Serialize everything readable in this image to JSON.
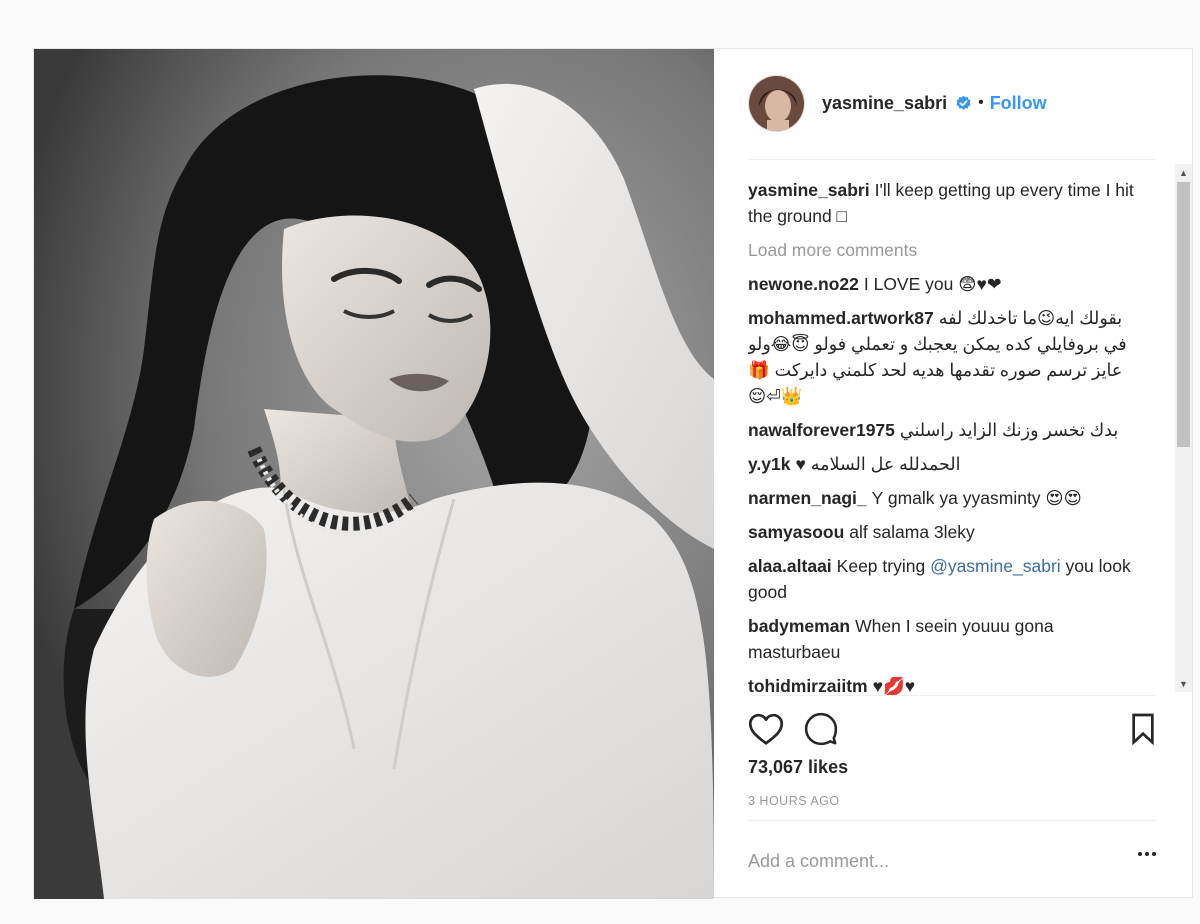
{
  "post": {
    "author": {
      "username": "yasmine_sabri",
      "verified": true,
      "follow_label": "Follow",
      "separator": "•"
    },
    "caption": {
      "user": "yasmine_sabri",
      "text": "I'll keep getting up every time I hit the ground □"
    },
    "load_more_label": "Load more comments",
    "comments": [
      {
        "user": "newone.no22",
        "text": "I LOVE you 😨♥❤"
      },
      {
        "user": "mohammed.artwork87",
        "text": "بقولك ايه😉ما تاخدلك لفه في بروفايلي كده يمكن يعجبك و تعملي فولو 😇😂ولو عايز ترسم صوره تقدمها هديه لحد كلمني دايركت 🎁👑⏎😌"
      },
      {
        "user": "nawalforever1975",
        "text": "بدك تخسر وزنك الزايد راسلني"
      },
      {
        "user": "y.y1k",
        "text": "الحمدلله عل السلامه ♥"
      },
      {
        "user": "narmen_nagi_",
        "text": "Y gmalk ya yyasminty 😍😍"
      },
      {
        "user": "samyasoou",
        "text": "alf salama 3leky"
      },
      {
        "user": "alaa.altaai",
        "text_before": "Keep trying ",
        "mention": "@yasmine_sabri",
        "text_after": " you look good"
      },
      {
        "user": "badymeman",
        "text": "When I seein youuu gona masturbaeu"
      },
      {
        "user": "tohidmirzaiitm",
        "text": "♥💋♥"
      }
    ],
    "likes": "73,067 likes",
    "time": "3 HOURS AGO",
    "add_comment_placeholder": "Add a comment...",
    "icons": {
      "like": "heart-icon",
      "comment": "comment-bubble-icon",
      "save": "bookmark-icon",
      "more": "more-options-icon",
      "verified": "verified-badge-icon"
    },
    "colors": {
      "link": "#3897f0",
      "muted": "#999999",
      "text": "#262626",
      "border": "#efefef"
    }
  }
}
